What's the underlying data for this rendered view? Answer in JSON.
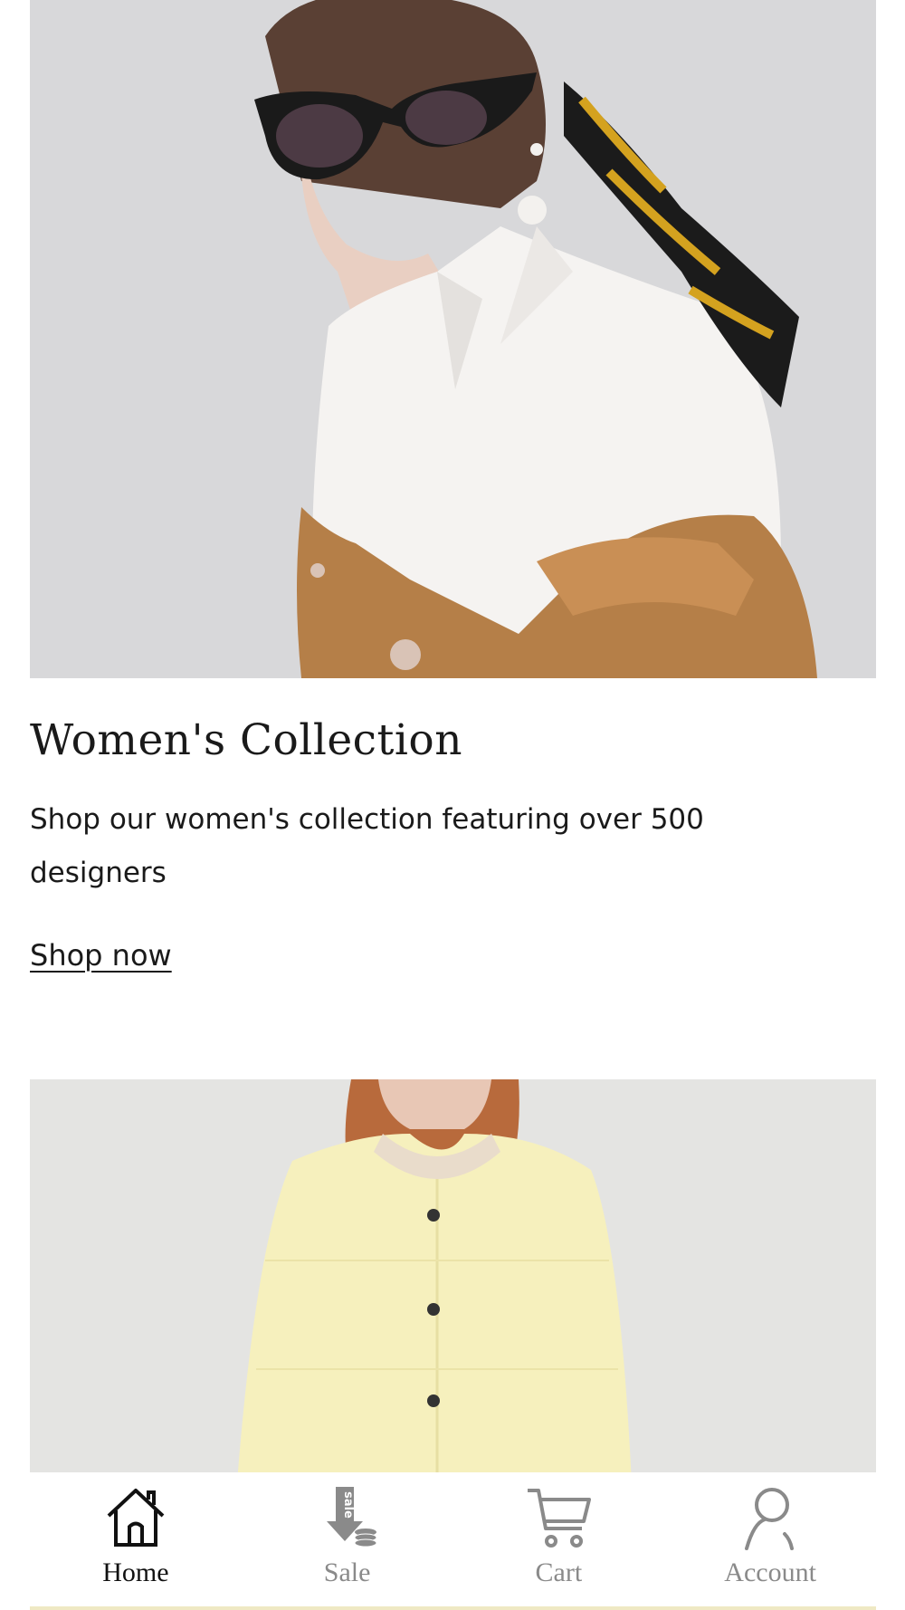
{
  "collection": {
    "title": "Women's Collection",
    "description": "Shop our women's collection featuring over 500 designers",
    "cta_label": "Shop now"
  },
  "bottom_nav": {
    "items": [
      {
        "label": "Home",
        "icon": "home-icon",
        "active": true
      },
      {
        "label": "Sale",
        "icon": "sale-icon",
        "active": false
      },
      {
        "label": "Cart",
        "icon": "cart-icon",
        "active": false
      },
      {
        "label": "Account",
        "icon": "account-icon",
        "active": false
      }
    ]
  },
  "sale_icon_text": "sale",
  "colors": {
    "background": "#ffffff",
    "text": "#1a1a1a",
    "nav_active": "#111111",
    "nav_inactive": "#8a8a8a"
  }
}
